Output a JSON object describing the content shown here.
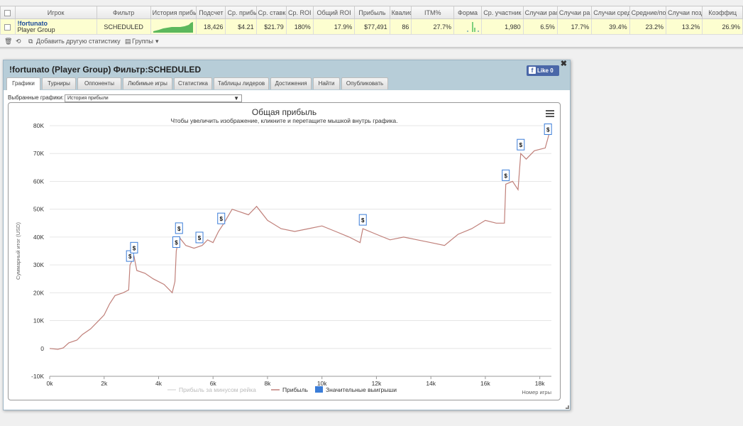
{
  "table": {
    "headers": [
      "Игрок",
      "Фильтр",
      "История прибы",
      "Подсчет",
      "Ср. прибы",
      "Ср. ставка",
      "Ср. ROI",
      "Общий ROI",
      "Прибыль",
      "Квалиф",
      "ITM%",
      "Форма",
      "Ср. участник",
      "Случаи рас",
      "Случаи ра",
      "Случаи сред",
      "Средние/поз",
      "Случаи позд",
      "Коэффиц"
    ],
    "row": {
      "player": "!fortunato",
      "group": "Player Group",
      "filter": "SCHEDULED",
      "count": "18,426",
      "avg_profit": "$4.21",
      "avg_stake": "$21.79",
      "avg_roi": "180%",
      "total_roi": "17.9%",
      "profit": "$77,491",
      "qualif": "86",
      "itm": "27.7%",
      "avg_entrants": "1,980",
      "c1": "6.5%",
      "c2": "17.7%",
      "c3": "39.4%",
      "c4": "23.2%",
      "c5": "13.2%",
      "c6": "26.9%"
    }
  },
  "toolbar": {
    "add_stat": "Добавить другую статистику",
    "groups": "Группы"
  },
  "panel": {
    "title": "!fortunato (Player Group) Фильтр:SCHEDULED",
    "like_label": "Like",
    "like_count": "0",
    "tabs": [
      "Графики",
      "Турниры",
      "Оппоненты",
      "Любимые игры",
      "Статистика",
      "Таблицы лидеров",
      "Достижения",
      "Найти",
      "Опубликовать"
    ],
    "select_label": "Выбранные графики:",
    "select_value": "История прибыли"
  },
  "chart_data": {
    "type": "line",
    "title": "Общая прибыль",
    "subtitle": "Чтобы увеличить изображение, кликните и перетащите мышкой внутрь графика.",
    "ylabel": "Суммарный итог (USD)",
    "xlabel": "Номер игры",
    "xlim": [
      0,
      18426
    ],
    "ylim": [
      -10000,
      80000
    ],
    "x_ticks": [
      "0k",
      "2k",
      "4k",
      "6k",
      "8k",
      "10k",
      "12k",
      "14k",
      "16k",
      "18k"
    ],
    "y_ticks": [
      "-10K",
      "0",
      "10K",
      "20K",
      "30K",
      "40K",
      "50K",
      "60K",
      "70K",
      "80K"
    ],
    "legend": [
      "Прибыль за минусом рейка",
      "Прибыль",
      "Значительные выигрыши"
    ],
    "series": [
      {
        "name": "Прибыль",
        "color": "#c0807a",
        "points": [
          [
            0,
            0
          ],
          [
            300,
            -300
          ],
          [
            500,
            200
          ],
          [
            700,
            2000
          ],
          [
            1000,
            3000
          ],
          [
            1200,
            5000
          ],
          [
            1500,
            7000
          ],
          [
            1800,
            10000
          ],
          [
            2000,
            12000
          ],
          [
            2200,
            16000
          ],
          [
            2400,
            19000
          ],
          [
            2700,
            20000
          ],
          [
            2900,
            21000
          ],
          [
            2950,
            30000
          ],
          [
            3100,
            33000
          ],
          [
            3200,
            28000
          ],
          [
            3500,
            27000
          ],
          [
            3800,
            25000
          ],
          [
            4200,
            23000
          ],
          [
            4500,
            20000
          ],
          [
            4600,
            24000
          ],
          [
            4650,
            35000
          ],
          [
            4750,
            40000
          ],
          [
            5000,
            37000
          ],
          [
            5300,
            36000
          ],
          [
            5600,
            37000
          ],
          [
            5800,
            39000
          ],
          [
            6000,
            38000
          ],
          [
            6200,
            42000
          ],
          [
            6400,
            45000
          ],
          [
            6700,
            50000
          ],
          [
            7000,
            49000
          ],
          [
            7300,
            48000
          ],
          [
            7600,
            51000
          ],
          [
            8000,
            46000
          ],
          [
            8500,
            43000
          ],
          [
            9000,
            42000
          ],
          [
            9500,
            43000
          ],
          [
            10000,
            44000
          ],
          [
            10500,
            42000
          ],
          [
            11000,
            40000
          ],
          [
            11400,
            38000
          ],
          [
            11500,
            43000
          ],
          [
            12000,
            41000
          ],
          [
            12500,
            39000
          ],
          [
            13000,
            40000
          ],
          [
            13500,
            39000
          ],
          [
            14000,
            38000
          ],
          [
            14500,
            37000
          ],
          [
            15000,
            41000
          ],
          [
            15500,
            43000
          ],
          [
            16000,
            46000
          ],
          [
            16400,
            45000
          ],
          [
            16700,
            45000
          ],
          [
            16750,
            59000
          ],
          [
            17000,
            60000
          ],
          [
            17200,
            57000
          ],
          [
            17300,
            70000
          ],
          [
            17500,
            68000
          ],
          [
            17800,
            71000
          ],
          [
            18200,
            72000
          ],
          [
            18426,
            80000
          ]
        ]
      }
    ],
    "big_wins_x": [
      2950,
      3100,
      4650,
      4750,
      5500,
      6300,
      11500,
      16750,
      17300,
      18300
    ]
  }
}
